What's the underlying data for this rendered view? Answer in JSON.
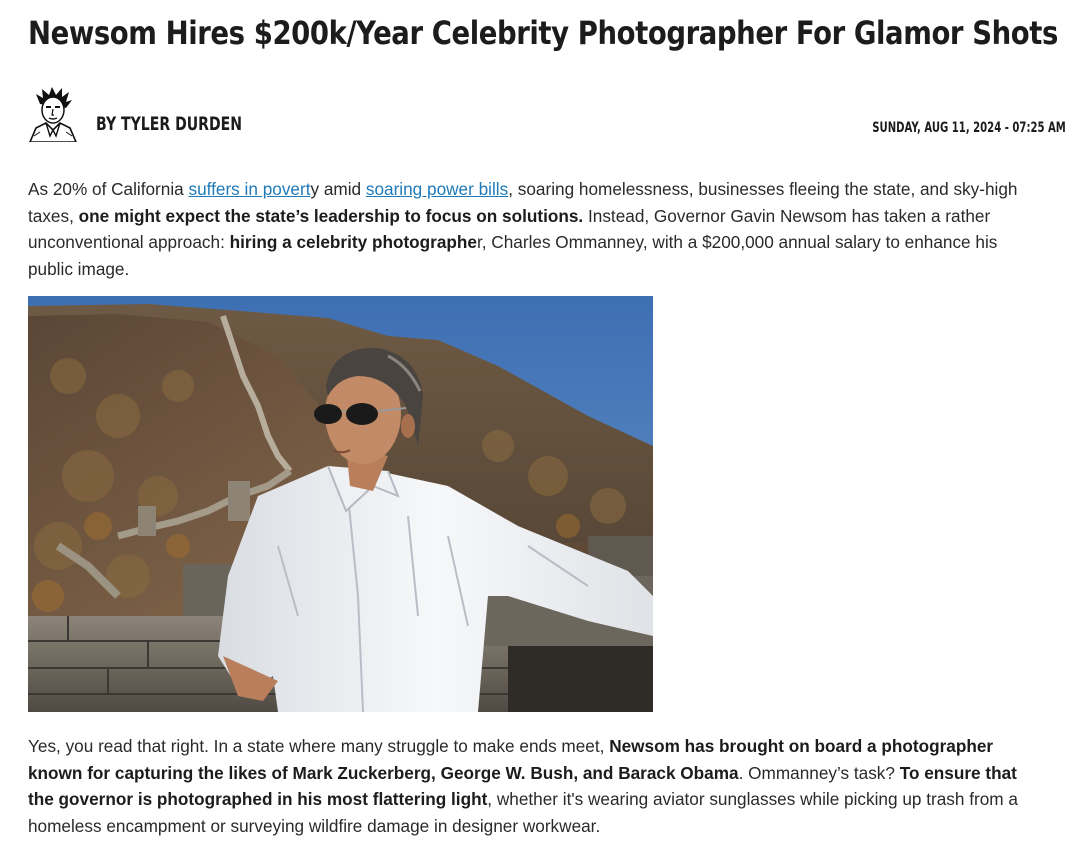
{
  "article": {
    "title": "Newsom Hires $200k/Year Celebrity Photographer For Glamor Shots",
    "author": "BY TYLER DURDEN",
    "date": "SUNDAY, AUG 11, 2024 - 07:25 AM"
  },
  "para1": {
    "t1": "As 20% of California ",
    "link1": "suffers in povert",
    "t2": "y amid ",
    "link2": "soaring power bills",
    "t3": ", soaring homelessness, businesses fleeing the state, and sky-high taxes, ",
    "b1": "one might expect the state’s leadership to focus on solutions.",
    "t4": " Instead, Governor Gavin Newsom has taken a rather unconventional approach: ",
    "b2": "hiring a celebrity photographe",
    "t5": "r, Charles Ommanney, with a $200,000 annual salary to enhance his public image."
  },
  "para2": {
    "t1": "Yes, you read that right. In a state where many struggle to make ends meet, ",
    "b1": "Newsom has brought on board a photographer known for capturing the likes of Mark Zuckerberg, George W. Bush, and Barack Obama",
    "t2": ". Ommanney’s task? ",
    "b2": "To ensure that the governor is photographed in his most flattering light",
    "t3": ", whether it's wearing aviator sunglasses while picking up trash from a homeless encampment or surveying wildfire damage in designer workwear."
  },
  "icons": {
    "author_avatar": "author-avatar-sketch",
    "article_photo": "newsom-great-wall-photo"
  },
  "colors": {
    "link": "#1e7ab8",
    "text": "#2a2a2a",
    "heading": "#1c1c1c"
  }
}
